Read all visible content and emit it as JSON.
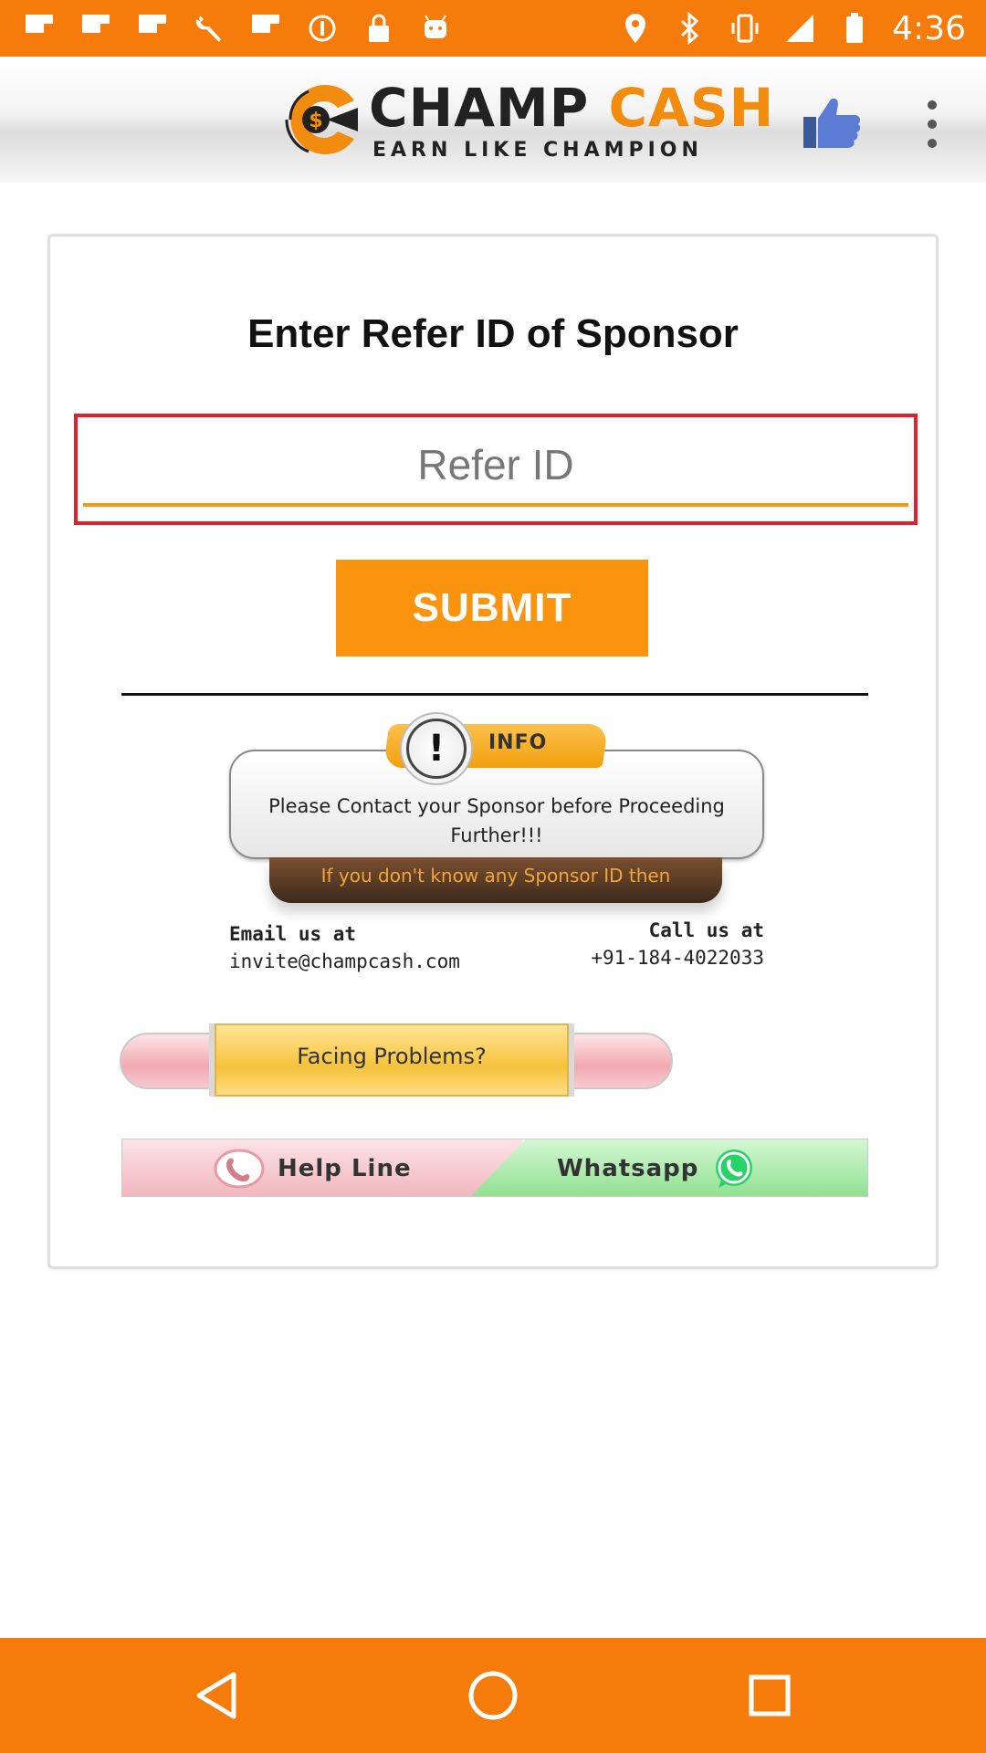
{
  "status_bar": {
    "time": "4:36",
    "left_icons": [
      "flipboard-icon",
      "flipboard-icon",
      "flipboard-icon",
      "wrench-icon",
      "flipboard-icon",
      "sync-icon",
      "lock-icon",
      "android-icon"
    ],
    "right_icons": [
      "location-icon",
      "bluetooth-icon",
      "vibrate-icon",
      "signal-icon",
      "battery-icon"
    ]
  },
  "header": {
    "logo_word1": "CHAMP",
    "logo_word2": "CASH",
    "logo_tagline": "EARN LIKE CHAMPION",
    "like_icon": "thumbs-up-icon",
    "menu_icon": "more-vert-icon"
  },
  "form": {
    "title": "Enter Refer ID of Sponsor",
    "input_value": "",
    "input_placeholder": "Refer ID",
    "submit_label": "SUBMIT"
  },
  "info": {
    "tab_label": "INFO",
    "exclamation": "!",
    "message": "Please Contact your Sponsor before Proceeding Further!!!",
    "ribbon_text": "If you don't know any Sponsor ID then",
    "email_label": "Email us at",
    "email_value": "invite@champcash.com",
    "call_label": "Call us at",
    "call_value": "+91-184-4022033"
  },
  "support": {
    "facing_label": "Facing Problems?",
    "helpline_label": "Help Line",
    "whatsapp_label": "Whatsapp"
  },
  "colors": {
    "brand_orange": "#f57c0a",
    "button_orange": "#fa930e",
    "input_outline_red": "#e0202a",
    "input_underline": "#f39a14"
  },
  "nav_bar": {
    "back_icon": "back-triangle-icon",
    "home_icon": "home-circle-icon",
    "recents_icon": "recents-square-icon"
  }
}
